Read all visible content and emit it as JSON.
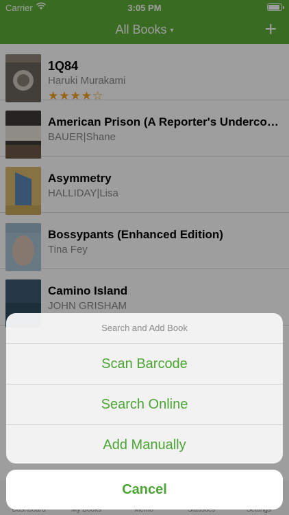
{
  "status": {
    "carrier": "Carrier",
    "time": "3:05 PM"
  },
  "nav": {
    "title": "All Books",
    "caret": "▾",
    "add": "+"
  },
  "books": [
    {
      "title": "1Q84",
      "author": "Haruki Murakami",
      "rating": "★★★★☆"
    },
    {
      "title": "American Prison (A Reporter's Undercover Jou...",
      "author": "BAUER|Shane"
    },
    {
      "title": "Asymmetry",
      "author": "HALLIDAY|Lisa"
    },
    {
      "title": "Bossypants (Enhanced Edition)",
      "author": "Tina Fey"
    },
    {
      "title": "Camino Island",
      "author": "JOHN GRISHAM"
    }
  ],
  "tabs": [
    "Dashboard",
    "My Books",
    "Memo",
    "Statistics",
    "Settings"
  ],
  "sheet": {
    "header": "Search and Add Book",
    "actions": [
      "Scan Barcode",
      "Search Online",
      "Add Manually"
    ],
    "cancel": "Cancel"
  },
  "colors": {
    "accent": "#5dae37",
    "action_text": "#4aa532",
    "rating": "#f0a020"
  },
  "icons": {
    "wifi": "wifi-icon",
    "battery": "battery-icon",
    "add": "plus-icon",
    "caret": "chevron-down-icon"
  }
}
